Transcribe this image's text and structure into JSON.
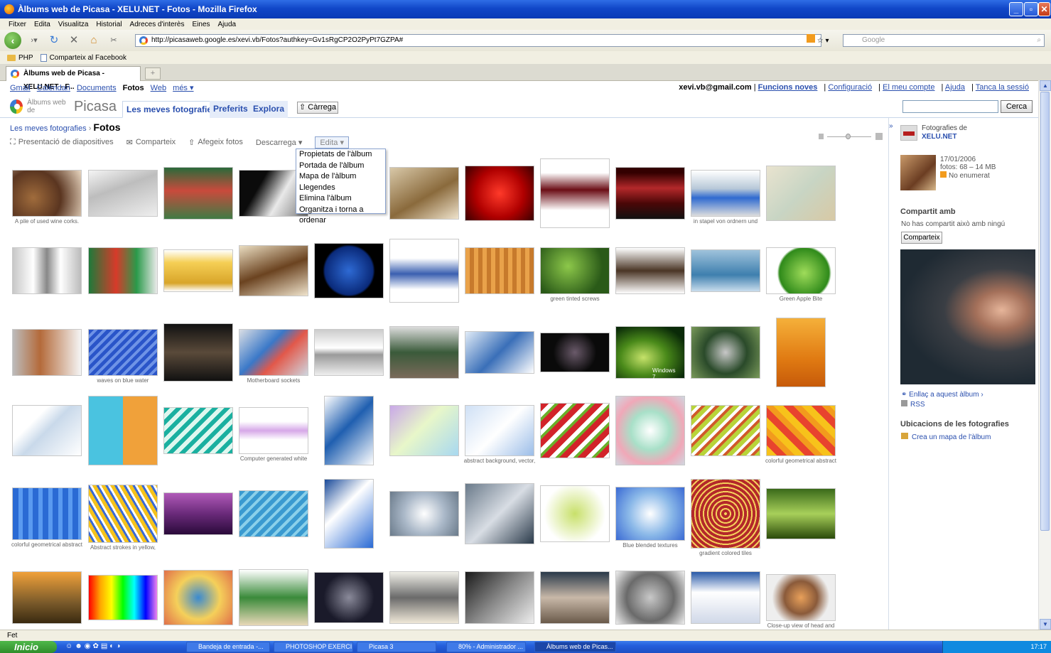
{
  "window": {
    "title": "Àlbums web de Picasa - XELU.NET - Fotos - Mozilla Firefox"
  },
  "menubar": [
    "Fitxer",
    "Edita",
    "Visualitza",
    "Historial",
    "Adreces d'interès",
    "Eines",
    "Ajuda"
  ],
  "browser": {
    "url": "http://picasaweb.google.es/xevi.vb/Fotos?authkey=Gv1sRgCP2O2PyPt7GZPA#",
    "search_placeholder": "Google",
    "bookmarks": [
      "PHP",
      "Comparteix al Facebook"
    ],
    "tab_title": "Àlbums web de Picasa - XELU.NET - F...",
    "new_tab": "+"
  },
  "gbar": {
    "links": [
      "Gmail",
      "Calendari",
      "Documents",
      "Fotos",
      "Web",
      "més ▾"
    ],
    "user_email": "xevi.vb@gmail.com",
    "user_links": [
      "Funcions noves",
      "Configuració",
      "El meu compte",
      "Ajuda",
      "Tanca la sessió"
    ]
  },
  "picasa": {
    "logo_small": "Àlbums web de",
    "logo_big": "Picasa",
    "tabs": [
      "Les meves fotografies",
      "Preferits",
      "Explora"
    ],
    "upload": "⇧ Càrrega",
    "search_button": "Cerca"
  },
  "breadcrumb": {
    "parent": "Les meves fotografies",
    "sep": "›",
    "current": "Fotos"
  },
  "toolbar": {
    "slideshow": "Presentació de diapositives",
    "share": "Comparteix",
    "add": "Afegeix fotos",
    "download": "Descarrega ▾",
    "edit": "Edita ▾"
  },
  "edit_menu": [
    "Propietats de l'àlbum",
    "Portada de l'àlbum",
    "Mapa de l'àlbum",
    "Llegendes",
    "Elimina l'àlbum",
    "Organitza i torna a ordenar"
  ],
  "captions": {
    "r0c0": "A pile of used wine corks.",
    "r0c9": "in stapel von ordnern und",
    "r1c7": "green tinted screws",
    "r1c10": "Green Apple Bite",
    "r2c1": "waves on blue water",
    "r2c3": "Motherboard sockets",
    "r3c3": "Computer generated white",
    "r3c6": "abstract background, vector,",
    "r3c10": "colorful geometrical abstract",
    "r4c0": "colorful geometrical abstract",
    "r4c1": "Abstract strokes in yellow,",
    "r4c8": "Blue blended textures",
    "r4c9": "gradient colored tiles",
    "r5c10": "Close-up view of head and"
  },
  "photo_text": {
    "win7": "Windows 7"
  },
  "sidebar": {
    "expand": "»",
    "owner_label": "Fotografies de",
    "owner_name": "XELU.NET",
    "date": "17/01/2006",
    "photos": "fotos: 68 – 14 MB",
    "visibility": "No enumerat",
    "shared_head": "Compartit amb",
    "shared_text": "No has compartit això amb ningú",
    "share_button": "Comparteix",
    "link_album": "Enllaç a aquest àlbum ›",
    "rss": "RSS",
    "locations_head": "Ubicacions de les fotografies",
    "create_map": "Crea un mapa de l'àlbum"
  },
  "status": "Fet",
  "taskbar": {
    "start": "Inicio",
    "tasks": [
      "Bandeja de entrada -...",
      "PHOTOSHOP EXERCI...",
      "Picasa 3",
      "80% - Administrador ...",
      "Àlbums web de Picas..."
    ],
    "clock": "17:17"
  }
}
